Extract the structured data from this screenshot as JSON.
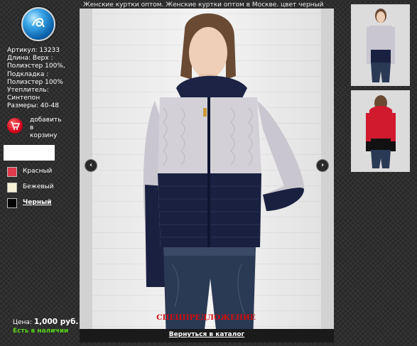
{
  "header": {
    "title": "Женские куртки оптом. Женские куртки оптом в Москве. цвет черный"
  },
  "product": {
    "specs": [
      "Артикул: 13233",
      "Длина: Верх :",
      "Полиэстер 100%,",
      "Подкладка :",
      "Полиэстер 100%",
      "Утеплитель:",
      "Синтепон",
      "Размеры: 40-48"
    ],
    "add_to_cart_lines": [
      "добавить",
      "в",
      "корзину"
    ],
    "price_label": "Цена:",
    "price_value": "1,000 руб.",
    "stock": "Есть в наличии"
  },
  "colors": [
    {
      "name": "Красный",
      "hex": "#e03a4c",
      "selected": false
    },
    {
      "name": "Бежевый",
      "hex": "#f7f1d6",
      "selected": false
    },
    {
      "name": "Черный",
      "hex": "#050505",
      "selected": true
    }
  ],
  "viewer": {
    "special_offer": "СПЕЦПРЕДЛОЖЕНИЕ",
    "back_link": "Вернуться в каталог",
    "prev_icon": "chevron-left-icon",
    "next_icon": "chevron-right-icon"
  },
  "thumbnails": [
    {
      "name": "jacket-navy-grey"
    },
    {
      "name": "jacket-red-black"
    }
  ]
}
